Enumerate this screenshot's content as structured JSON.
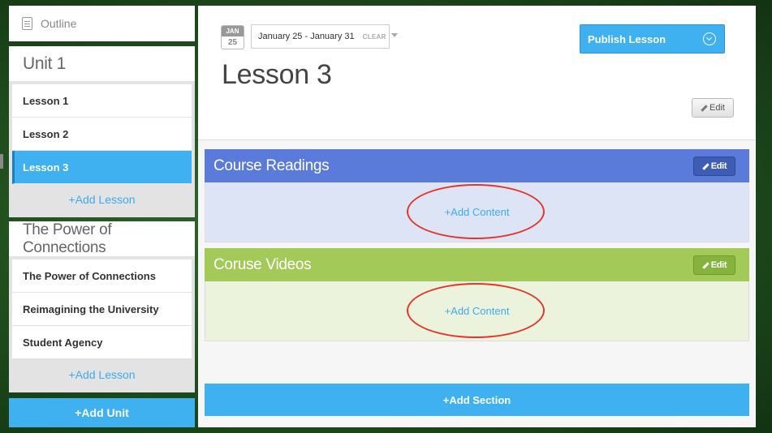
{
  "sidebar": {
    "outline_label": "Outline",
    "units": [
      {
        "title": "Unit 1",
        "lessons": [
          "Lesson 1",
          "Lesson 2",
          "Lesson 3"
        ],
        "active_lesson": "Lesson 3",
        "add_lesson_label": "+Add Lesson"
      },
      {
        "title": "The Power of Connections",
        "lessons": [
          "The Power of Connections",
          "Reimagining the University",
          "Student Agency"
        ],
        "add_lesson_label": "+Add Lesson"
      }
    ],
    "add_unit_label": "+Add Unit"
  },
  "header": {
    "calendar_month": "JAN",
    "calendar_day": "25",
    "date_range": "January 25 - January 31",
    "clear_label": "CLEAR",
    "lesson_title": "Lesson 3",
    "publish_label": "Publish Lesson",
    "edit_label": "Edit"
  },
  "sections": [
    {
      "title": "Course Readings",
      "edit_label": "Edit",
      "add_content_label": "+Add Content",
      "color": "#5a7bd9"
    },
    {
      "title": "Coruse Videos",
      "edit_label": "Edit",
      "add_content_label": "+Add Content",
      "color": "#a3c958"
    }
  ],
  "add_section_label": "+Add Section",
  "colors": {
    "accent": "#3fb1f0",
    "annotation": "#e4352a"
  }
}
